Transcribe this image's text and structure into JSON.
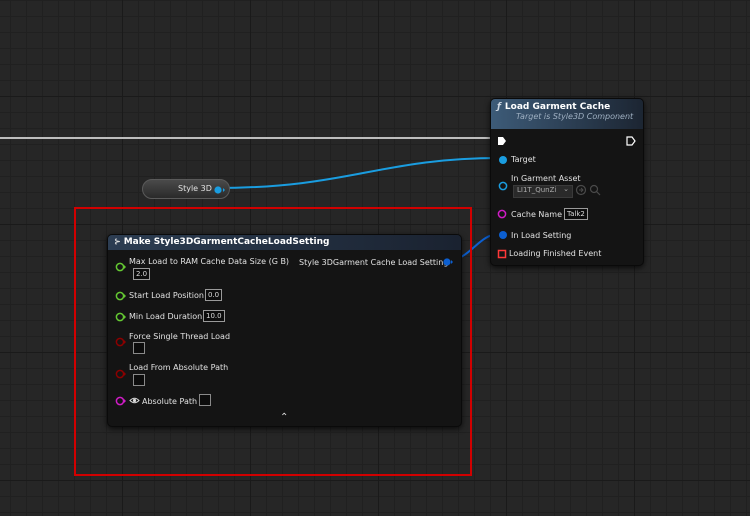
{
  "graph": {
    "style3d_node": {
      "label": "Style 3D"
    },
    "load_garment_cache": {
      "title": "Load Garment Cache",
      "subtitle": "Target is Style3D Component",
      "function_icon": "function-icon",
      "pins": {
        "target": "Target",
        "garment_asset": "In Garment Asset",
        "garment_asset_value": "LI1T_QunZi",
        "cache_name": "Cache Name",
        "cache_name_value": "Talk2",
        "load_setting": "In Load Setting",
        "loading_finished": "Loading Finished Event"
      }
    },
    "make_setting": {
      "title": "Make Style3DGarmentCacheLoadSetting",
      "output": "Style 3DGarment Cache Load Setting",
      "pins": {
        "max_load": "Max Load to RAM Cache Data Size (G B)",
        "max_load_value": "2.0",
        "start_load": "Start Load Position",
        "start_load_value": "0.0",
        "min_load": "Min Load Duration",
        "min_load_value": "10.0",
        "force_single": "Force Single Thread Load",
        "load_abs": "Load From Absolute Path",
        "abs_path": "Absolute Path"
      },
      "collapse_glyph": "⌃"
    }
  },
  "colors": {
    "float_pin": "#64c832",
    "bool_pin": "#8c0000",
    "string_pin": "#d01cc6",
    "struct_pin": "#0c5fd0",
    "object_pin": "#1a9de0",
    "exec_pin": "#ffffff",
    "delegate_pin": "#ff3838",
    "selection_box": "#d10000",
    "function_header": "#3d5b78",
    "make_header": "#2c3d52"
  }
}
